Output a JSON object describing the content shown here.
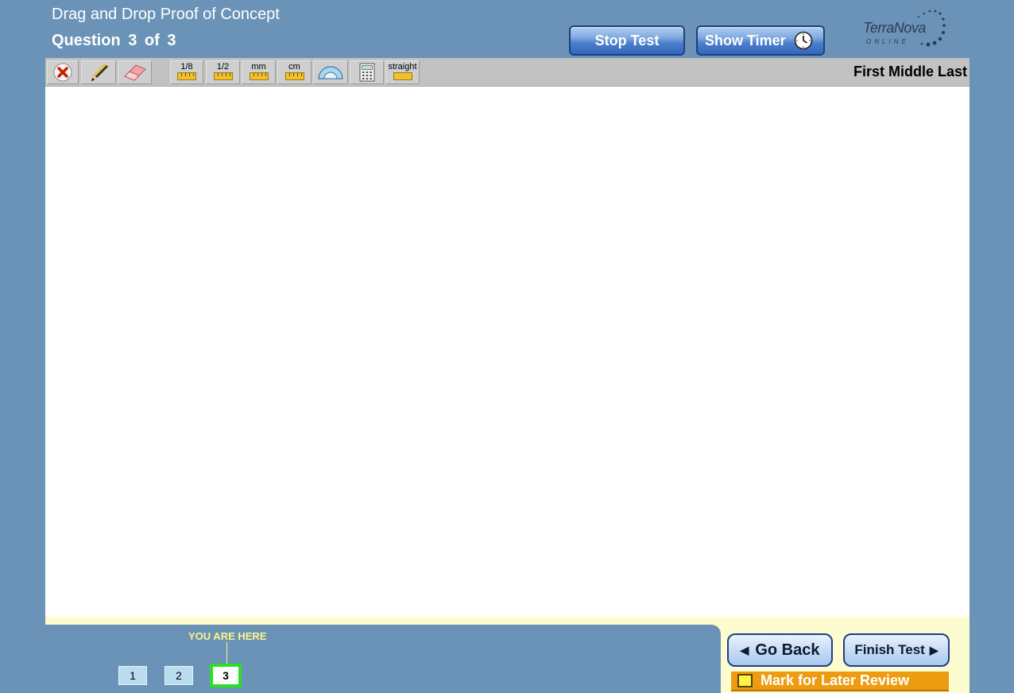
{
  "header": {
    "test_title": "Drag and Drop Proof of Concept",
    "question_counter": "Question  3  of  3",
    "stop_test_label": "Stop Test",
    "show_timer_label": "Show Timer",
    "logo_text": "TerraNova",
    "logo_subtext": "ONLINE"
  },
  "toolbar": {
    "tools": [
      {
        "name": "close",
        "icon": "x-circle-icon"
      },
      {
        "name": "pencil",
        "icon": "pencil-icon"
      },
      {
        "name": "eraser",
        "icon": "eraser-icon"
      },
      {
        "name": "ruler-eighth",
        "label": "1/8",
        "icon": "ruler-icon"
      },
      {
        "name": "ruler-half",
        "label": "1/2",
        "icon": "ruler-icon"
      },
      {
        "name": "ruler-mm",
        "label": "mm",
        "icon": "ruler-icon"
      },
      {
        "name": "ruler-cm",
        "label": "cm",
        "icon": "ruler-icon"
      },
      {
        "name": "protractor",
        "icon": "protractor-icon"
      },
      {
        "name": "calculator",
        "icon": "calculator-icon"
      },
      {
        "name": "straightedge",
        "label": "straight",
        "icon": "straightedge-icon"
      }
    ],
    "student_name": "First Middle Last"
  },
  "footer": {
    "you_are_here": "YOU ARE HERE",
    "questions": [
      "1",
      "2",
      "3"
    ],
    "current_question": "3",
    "go_back_label": "Go Back",
    "finish_test_label": "Finish Test",
    "mark_review_label": "Mark for Later Review"
  },
  "colors": {
    "background": "#6a93b7",
    "toolbar": "#c2c2c2",
    "footer_cream": "#fdfbd0",
    "current_question_border": "#27e024",
    "mark_review": "#ed9c11"
  }
}
